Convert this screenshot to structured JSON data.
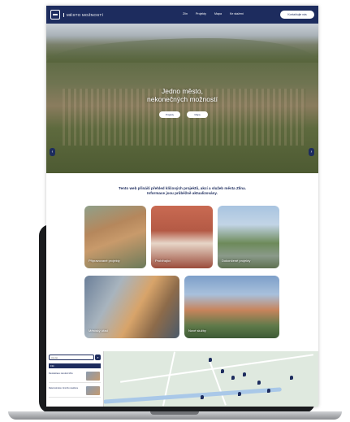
{
  "navbar": {
    "logo_text": "MĚSTO MOŽNOSTÍ",
    "menu": [
      "Zlín",
      "Projekty",
      "Mapa",
      "Ke stažení"
    ],
    "cta_label": "Kontaktujte nás"
  },
  "hero": {
    "title_line1": "Jedno město,",
    "title_line2": "nekonečných možností",
    "button_primary": "Projekty",
    "button_secondary": "Mapa",
    "arrow_left": "‹",
    "arrow_right": "›"
  },
  "intro": {
    "line1": "Tento web přináší přehled klíčových projektů, akcí a služeb města Zlína.",
    "line2": "Informace jsou průběžně aktualizovány."
  },
  "tiles": [
    {
      "label": "Připravované projekty"
    },
    {
      "label": "Probíhající"
    },
    {
      "label": "Dokončené projekty"
    },
    {
      "label": "Městský úřad"
    },
    {
      "label": "Nové služby"
    }
  ],
  "map": {
    "search_placeholder": "Hledat…",
    "search_button": "⌕",
    "filter_label": "Filtr",
    "list": [
      {
        "title": "Revitalizace náměstí Míru"
      },
      {
        "title": "Rekonstrukce zimního stadionu"
      }
    ]
  },
  "colors": {
    "brand_navy": "#1d2c5e",
    "laptop_body": "#1b1c1f"
  },
  "icons": [
    "logo-icon",
    "search-icon",
    "map-pin-icon",
    "chevron-left-icon",
    "chevron-right-icon"
  ]
}
